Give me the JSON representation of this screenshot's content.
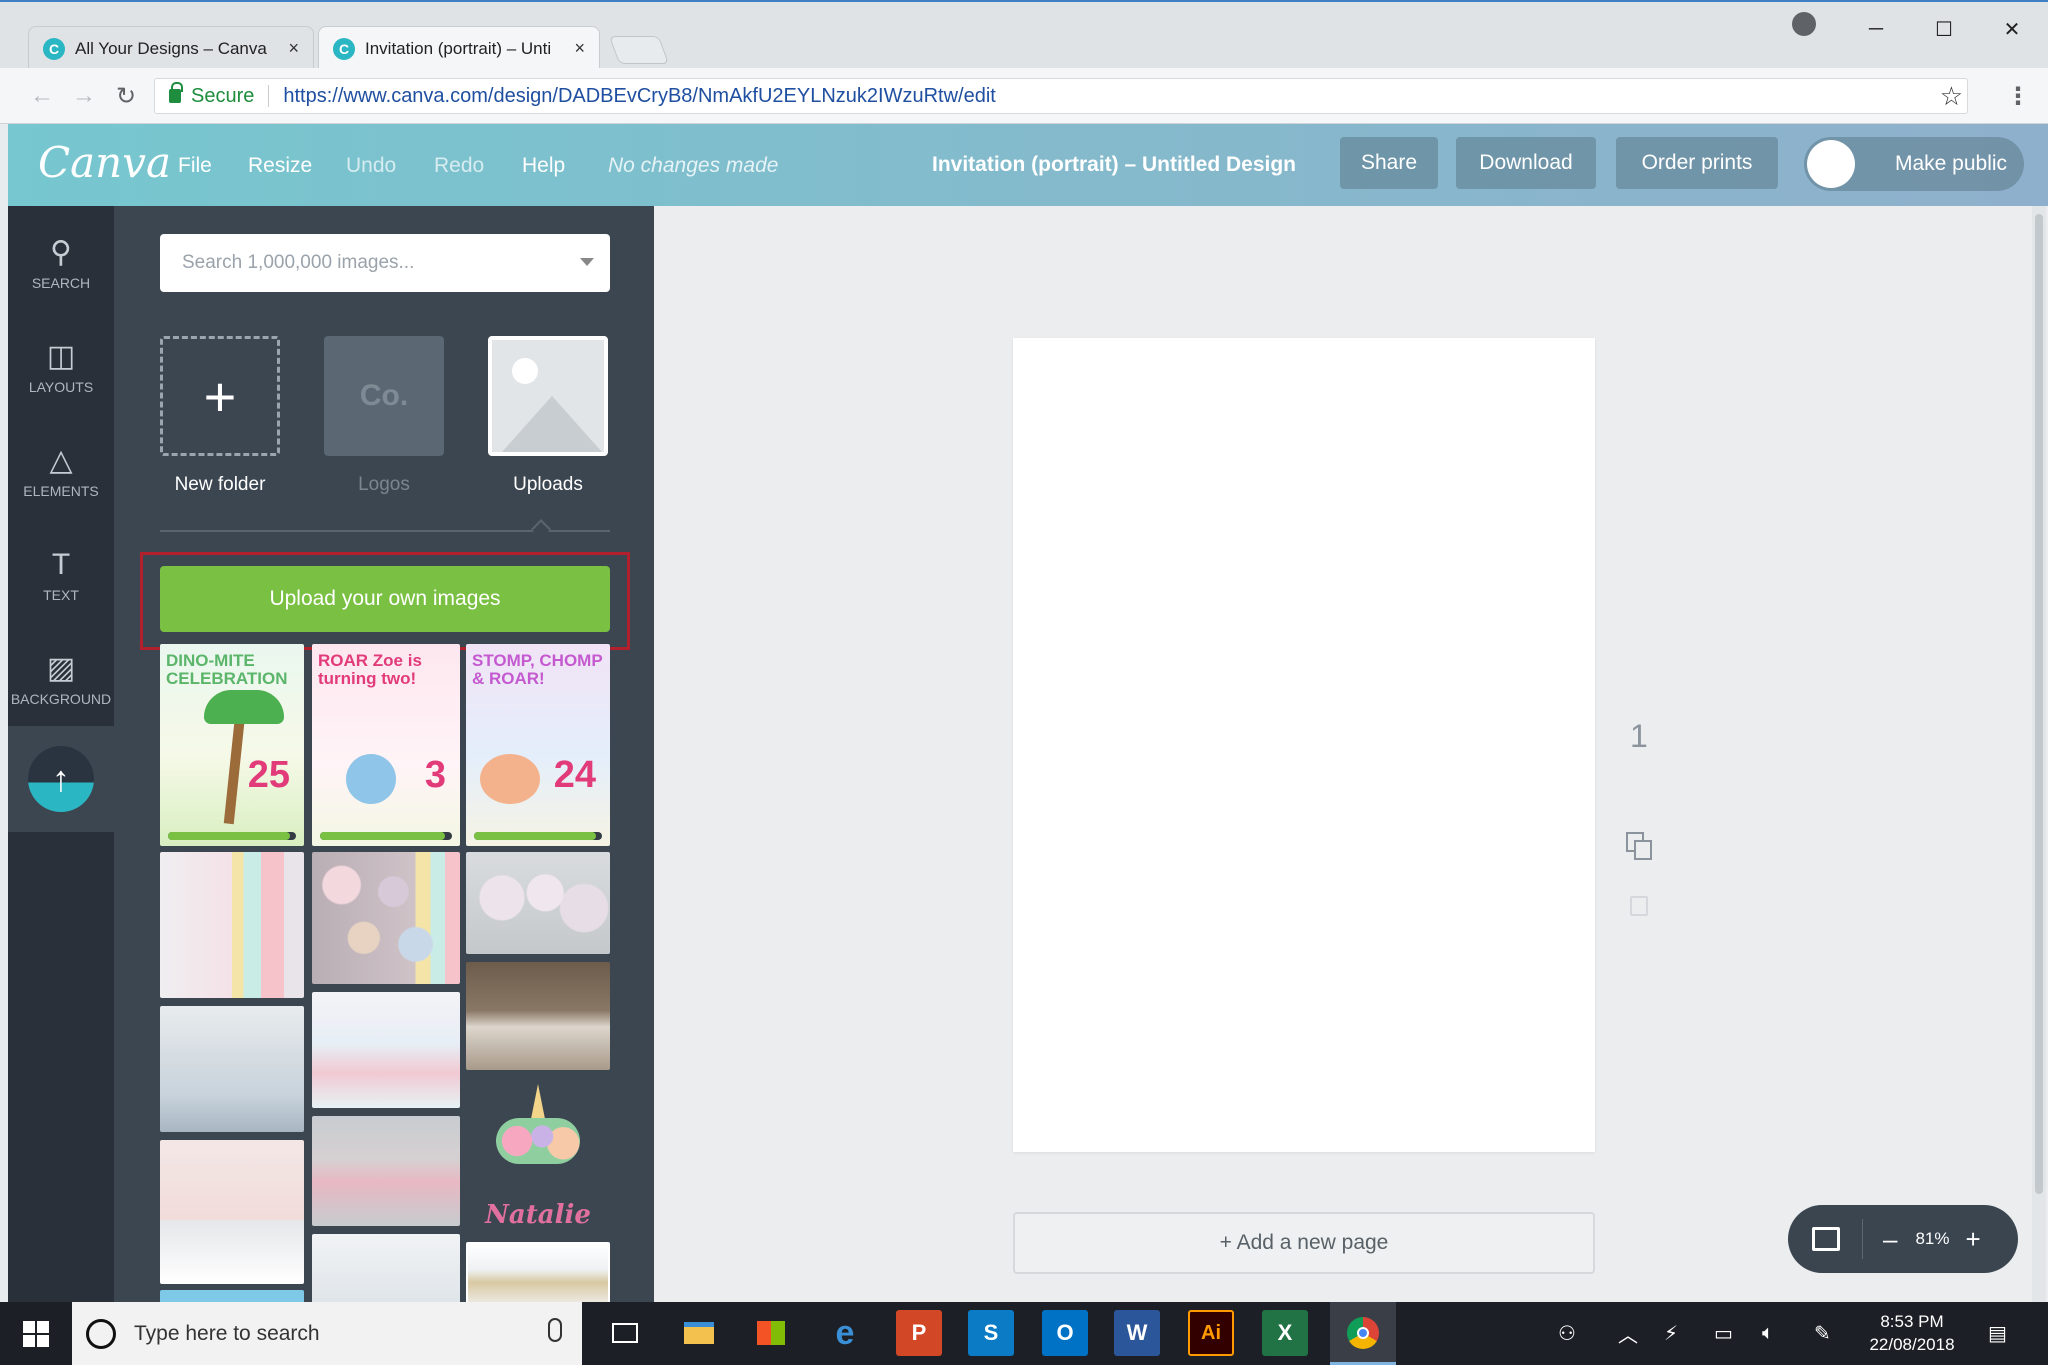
{
  "browser": {
    "tabs": [
      {
        "title": "All Your Designs – Canva",
        "close": "×"
      },
      {
        "title": "Invitation (portrait) – Unti",
        "close": "×"
      }
    ],
    "security_label": "Secure",
    "url": "https://www.canva.com/design/DADBEvCryB8/NmAkfU2EYLNzuk2IWzuRtw/edit",
    "icons": {
      "back": "←",
      "forward": "→",
      "reload": "↻",
      "star": "☆",
      "menu": "⋮",
      "minimize": "─",
      "maximize": "☐",
      "close": "✕"
    }
  },
  "header": {
    "logo": "Canva",
    "menu": [
      "File",
      "Resize",
      "Undo",
      "Redo",
      "Help"
    ],
    "status": "No changes made",
    "design_title": "Invitation (portrait) – Untitled Design",
    "buttons": {
      "share": "Share",
      "download": "Download",
      "order_prints": "Order prints",
      "make_public": "Make public"
    }
  },
  "rail": {
    "items": [
      {
        "label": "SEARCH",
        "icon": "⚲"
      },
      {
        "label": "LAYOUTS",
        "icon": "◫"
      },
      {
        "label": "ELEMENTS",
        "icon": "△"
      },
      {
        "label": "TEXT",
        "icon": "T"
      },
      {
        "label": "BACKGROUND",
        "icon": "▨"
      }
    ],
    "upload_icon": "↑"
  },
  "panel": {
    "search_placeholder": "Search 1,000,000 images...",
    "folders": [
      {
        "label": "New folder",
        "glyph": "+"
      },
      {
        "label": "Logos",
        "glyph": "Co."
      },
      {
        "label": "Uploads"
      }
    ],
    "upload_button": "Upload your own images",
    "invites": [
      {
        "text": "DINO-MITE CELEBRATION",
        "number": "25",
        "progress": 0.95
      },
      {
        "text": "ROAR Zoe is turning two!",
        "number": "3",
        "progress": 0.95
      },
      {
        "text": "STOMP, CHOMP & ROAR!",
        "number": "24",
        "progress": 0.95
      }
    ],
    "name_tile": "Natalie"
  },
  "canvas": {
    "page_number": "1",
    "add_page": "+ Add a new page",
    "zoom": "81%",
    "zoom_minus": "–",
    "zoom_plus": "+"
  },
  "taskbar": {
    "search_placeholder": "Type here to search",
    "time": "8:53 PM",
    "date": "22/08/2018",
    "apps": [
      "task-view",
      "file-explorer",
      "store",
      "edge",
      "powerpoint",
      "sharepoint",
      "outlook",
      "word",
      "illustrator",
      "excel",
      "chrome"
    ]
  },
  "colors": {
    "header": "#7fc0d0",
    "rail": "#293039",
    "panel": "#3c4651",
    "upload_green": "#7ac043",
    "highlight_red": "#b21f2d"
  }
}
